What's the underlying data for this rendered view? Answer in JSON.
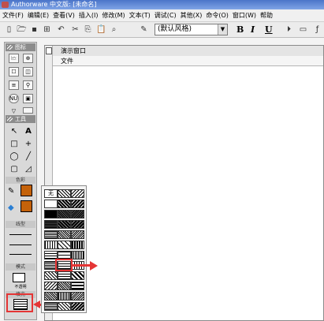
{
  "app": {
    "title": "Authorware 中文版: [未命名]"
  },
  "menubar": {
    "items": [
      "文件(F)",
      "编辑(E)",
      "查看(V)",
      "插入(I)",
      "修改(M)",
      "文本(T)",
      "调试(C)",
      "其他(X)",
      "命令(O)",
      "窗口(W)",
      "帮助"
    ]
  },
  "toolbar": {
    "style_value": "(默认风格)",
    "bold_label": "B",
    "italic_label": "I",
    "underline_label": "U"
  },
  "icon_panel": {
    "title": "图标",
    "icons": [
      "🗠",
      "⊕",
      "☐",
      "◫",
      "≡",
      "⚲",
      "NUT",
      "▣"
    ],
    "tools_title": "工具",
    "tools": [
      "↖",
      "A",
      "□",
      "+",
      "◯",
      "╱",
      "▢",
      "◿"
    ],
    "color_label": "色彩",
    "line_label": "线型",
    "mode_label": "模式",
    "mode_value": "不透明",
    "fill_label": "填充"
  },
  "presentation": {
    "title": "演示窗口",
    "menu_file": "文件"
  },
  "fill_popup": {
    "none_label": "无"
  },
  "colors": {
    "stroke_color": "#c4620a",
    "fill_color": "#c4620a",
    "annotation": "#e53535",
    "titlebar": "#4a74c9"
  }
}
